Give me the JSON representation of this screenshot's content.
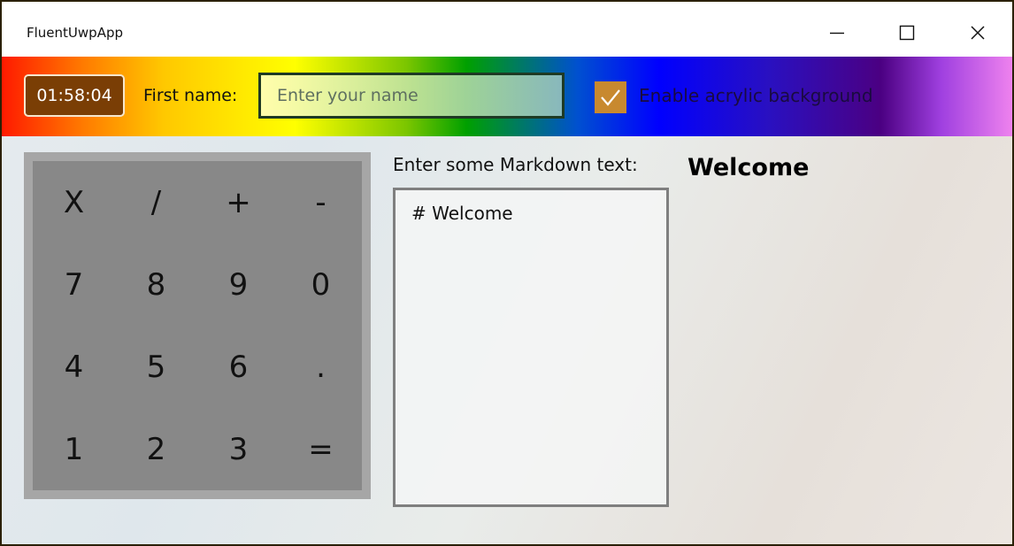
{
  "window": {
    "title": "FluentUwpApp"
  },
  "titlebar_buttons": {
    "minimize": "minimize-icon",
    "maximize": "maximize-icon",
    "close": "close-icon"
  },
  "header": {
    "clock": "01:58:04",
    "first_name_label": "First name:",
    "name_placeholder": "Enter your name",
    "name_value": "",
    "acrylic_checked": true,
    "acrylic_label": "Enable acrylic background",
    "accent_color": "#c8892f"
  },
  "calculator": {
    "keys": [
      "X",
      "/",
      "+",
      "-",
      "7",
      "8",
      "9",
      "0",
      "4",
      "5",
      "6",
      ".",
      "1",
      "2",
      "3",
      "="
    ]
  },
  "markdown": {
    "label": "Enter some Markdown text:",
    "input_value": "# Welcome",
    "preview_heading": "Welcome"
  }
}
